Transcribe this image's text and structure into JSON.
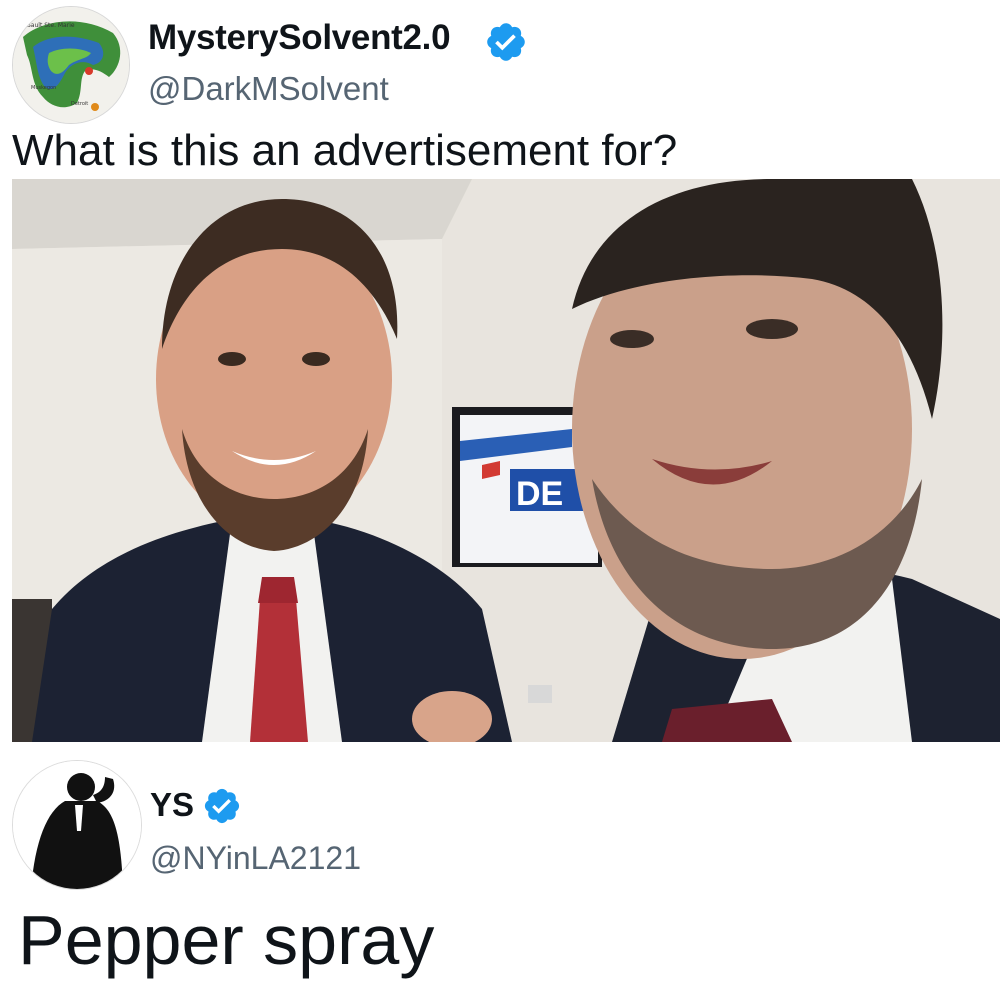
{
  "post": {
    "author_name": "MysterySolvent2.0",
    "author_handle": "@DarkMSolvent",
    "verified_icon": "verified-badge-icon",
    "text": "What is this an advertisement for?",
    "image": {
      "screen_text": "DE",
      "description_icon": "photo-two-men-selfie"
    }
  },
  "reply": {
    "author_name": "YS",
    "author_handle": "@NYinLA2121",
    "verified_icon": "verified-badge-icon",
    "text": "Pepper spray"
  },
  "colors": {
    "verified_blue": "#1d9bf0",
    "handle_gray": "#566573",
    "text_dark": "#0f1419"
  }
}
